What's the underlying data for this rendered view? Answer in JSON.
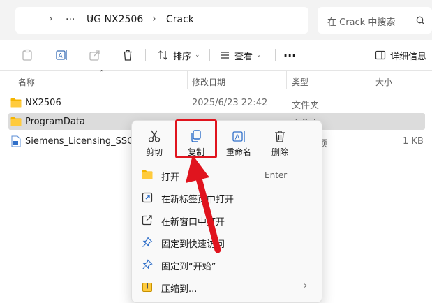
{
  "address": {
    "more": "···",
    "crumbs": [
      "UG NX2506",
      "Crack"
    ]
  },
  "search": {
    "placeholder": "在 Crack 中搜索"
  },
  "toolbar": {
    "sort_label": "排序",
    "view_label": "查看",
    "more_label": "···",
    "details_label": "详细信息"
  },
  "columns": {
    "name": "名称",
    "date": "修改日期",
    "type": "类型",
    "size": "大小"
  },
  "files": [
    {
      "name": "NX2506",
      "date": "2025/6/23 22:42",
      "type": "文件夹",
      "size": ""
    },
    {
      "name": "ProgramData",
      "date": "",
      "type": "文件夹",
      "size": ""
    },
    {
      "name": "Siemens_Licensing_SSQ",
      "date": "",
      "type": "项",
      "size": "1 KB"
    }
  ],
  "context_menu": {
    "quick_actions": [
      {
        "label": "剪切",
        "icon": "scissors-icon"
      },
      {
        "label": "复制",
        "icon": "copy-icon"
      },
      {
        "label": "重命名",
        "icon": "rename-icon"
      },
      {
        "label": "删除",
        "icon": "trash-icon"
      }
    ],
    "items": [
      {
        "label": "打开",
        "shortcut": "Enter",
        "icon": "folder-icon"
      },
      {
        "label": "在新标签页中打开",
        "icon": "open-new-tab-icon"
      },
      {
        "label": "在新窗口中打开",
        "icon": "open-new-window-icon"
      },
      {
        "label": "固定到快速访问",
        "icon": "pin-icon"
      },
      {
        "label": "固定到“开始”",
        "icon": "pin-icon"
      },
      {
        "label": "压缩到...",
        "submenu_glyph": "›",
        "icon": "zip-icon"
      }
    ]
  },
  "colors": {
    "highlight": "#e0141e",
    "folder": "#f4b400",
    "selection": "#dcdcdc"
  }
}
